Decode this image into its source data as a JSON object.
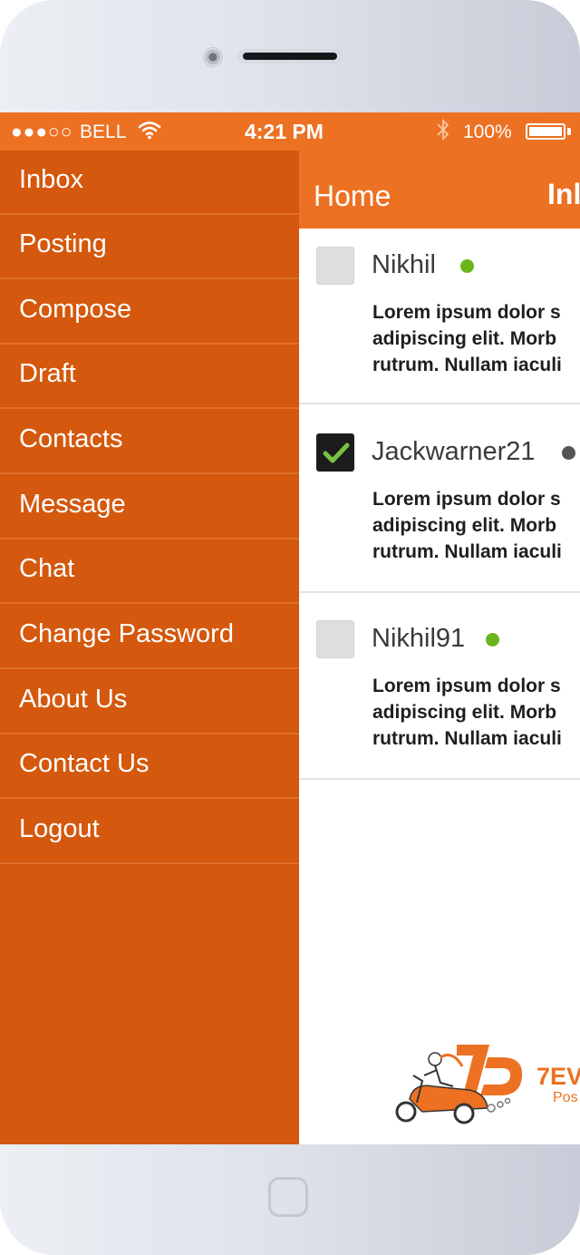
{
  "status_bar": {
    "signal": "●●●○○",
    "carrier": "BELL",
    "time": "4:21 PM",
    "battery": "100%"
  },
  "header": {
    "home_label": "Home",
    "title": "Inl"
  },
  "menu": {
    "items": [
      {
        "label": "Inbox"
      },
      {
        "label": "Posting"
      },
      {
        "label": "Compose"
      },
      {
        "label": "Draft"
      },
      {
        "label": "Contacts"
      },
      {
        "label": "Message"
      },
      {
        "label": "Chat"
      },
      {
        "label": "Change Password"
      },
      {
        "label": "About Us"
      },
      {
        "label": "Contact Us"
      },
      {
        "label": "Logout"
      }
    ]
  },
  "messages": [
    {
      "sender": "Nikhil",
      "checked": false,
      "status_color": "#6ab51a",
      "preview": [
        "Lorem ipsum dolor s",
        "adipiscing elit. Morb",
        "rutrum. Nullam iaculi"
      ]
    },
    {
      "sender": "Jackwarner21",
      "checked": true,
      "status_color": "#555555",
      "preview": [
        "Lorem ipsum dolor s",
        "adipiscing elit. Morb",
        "rutrum. Nullam iaculi"
      ]
    },
    {
      "sender": "Nikhil91",
      "checked": false,
      "status_color": "#6ab51a",
      "preview": [
        "Lorem ipsum dolor s",
        "adipiscing elit. Morb",
        "rutrum. Nullam iaculi"
      ]
    }
  ],
  "logo": {
    "brand": "7EV",
    "sub": "Pos"
  },
  "colors": {
    "accent": "#ec7123",
    "drawer": "#d4580d",
    "check": "#7bc043"
  }
}
